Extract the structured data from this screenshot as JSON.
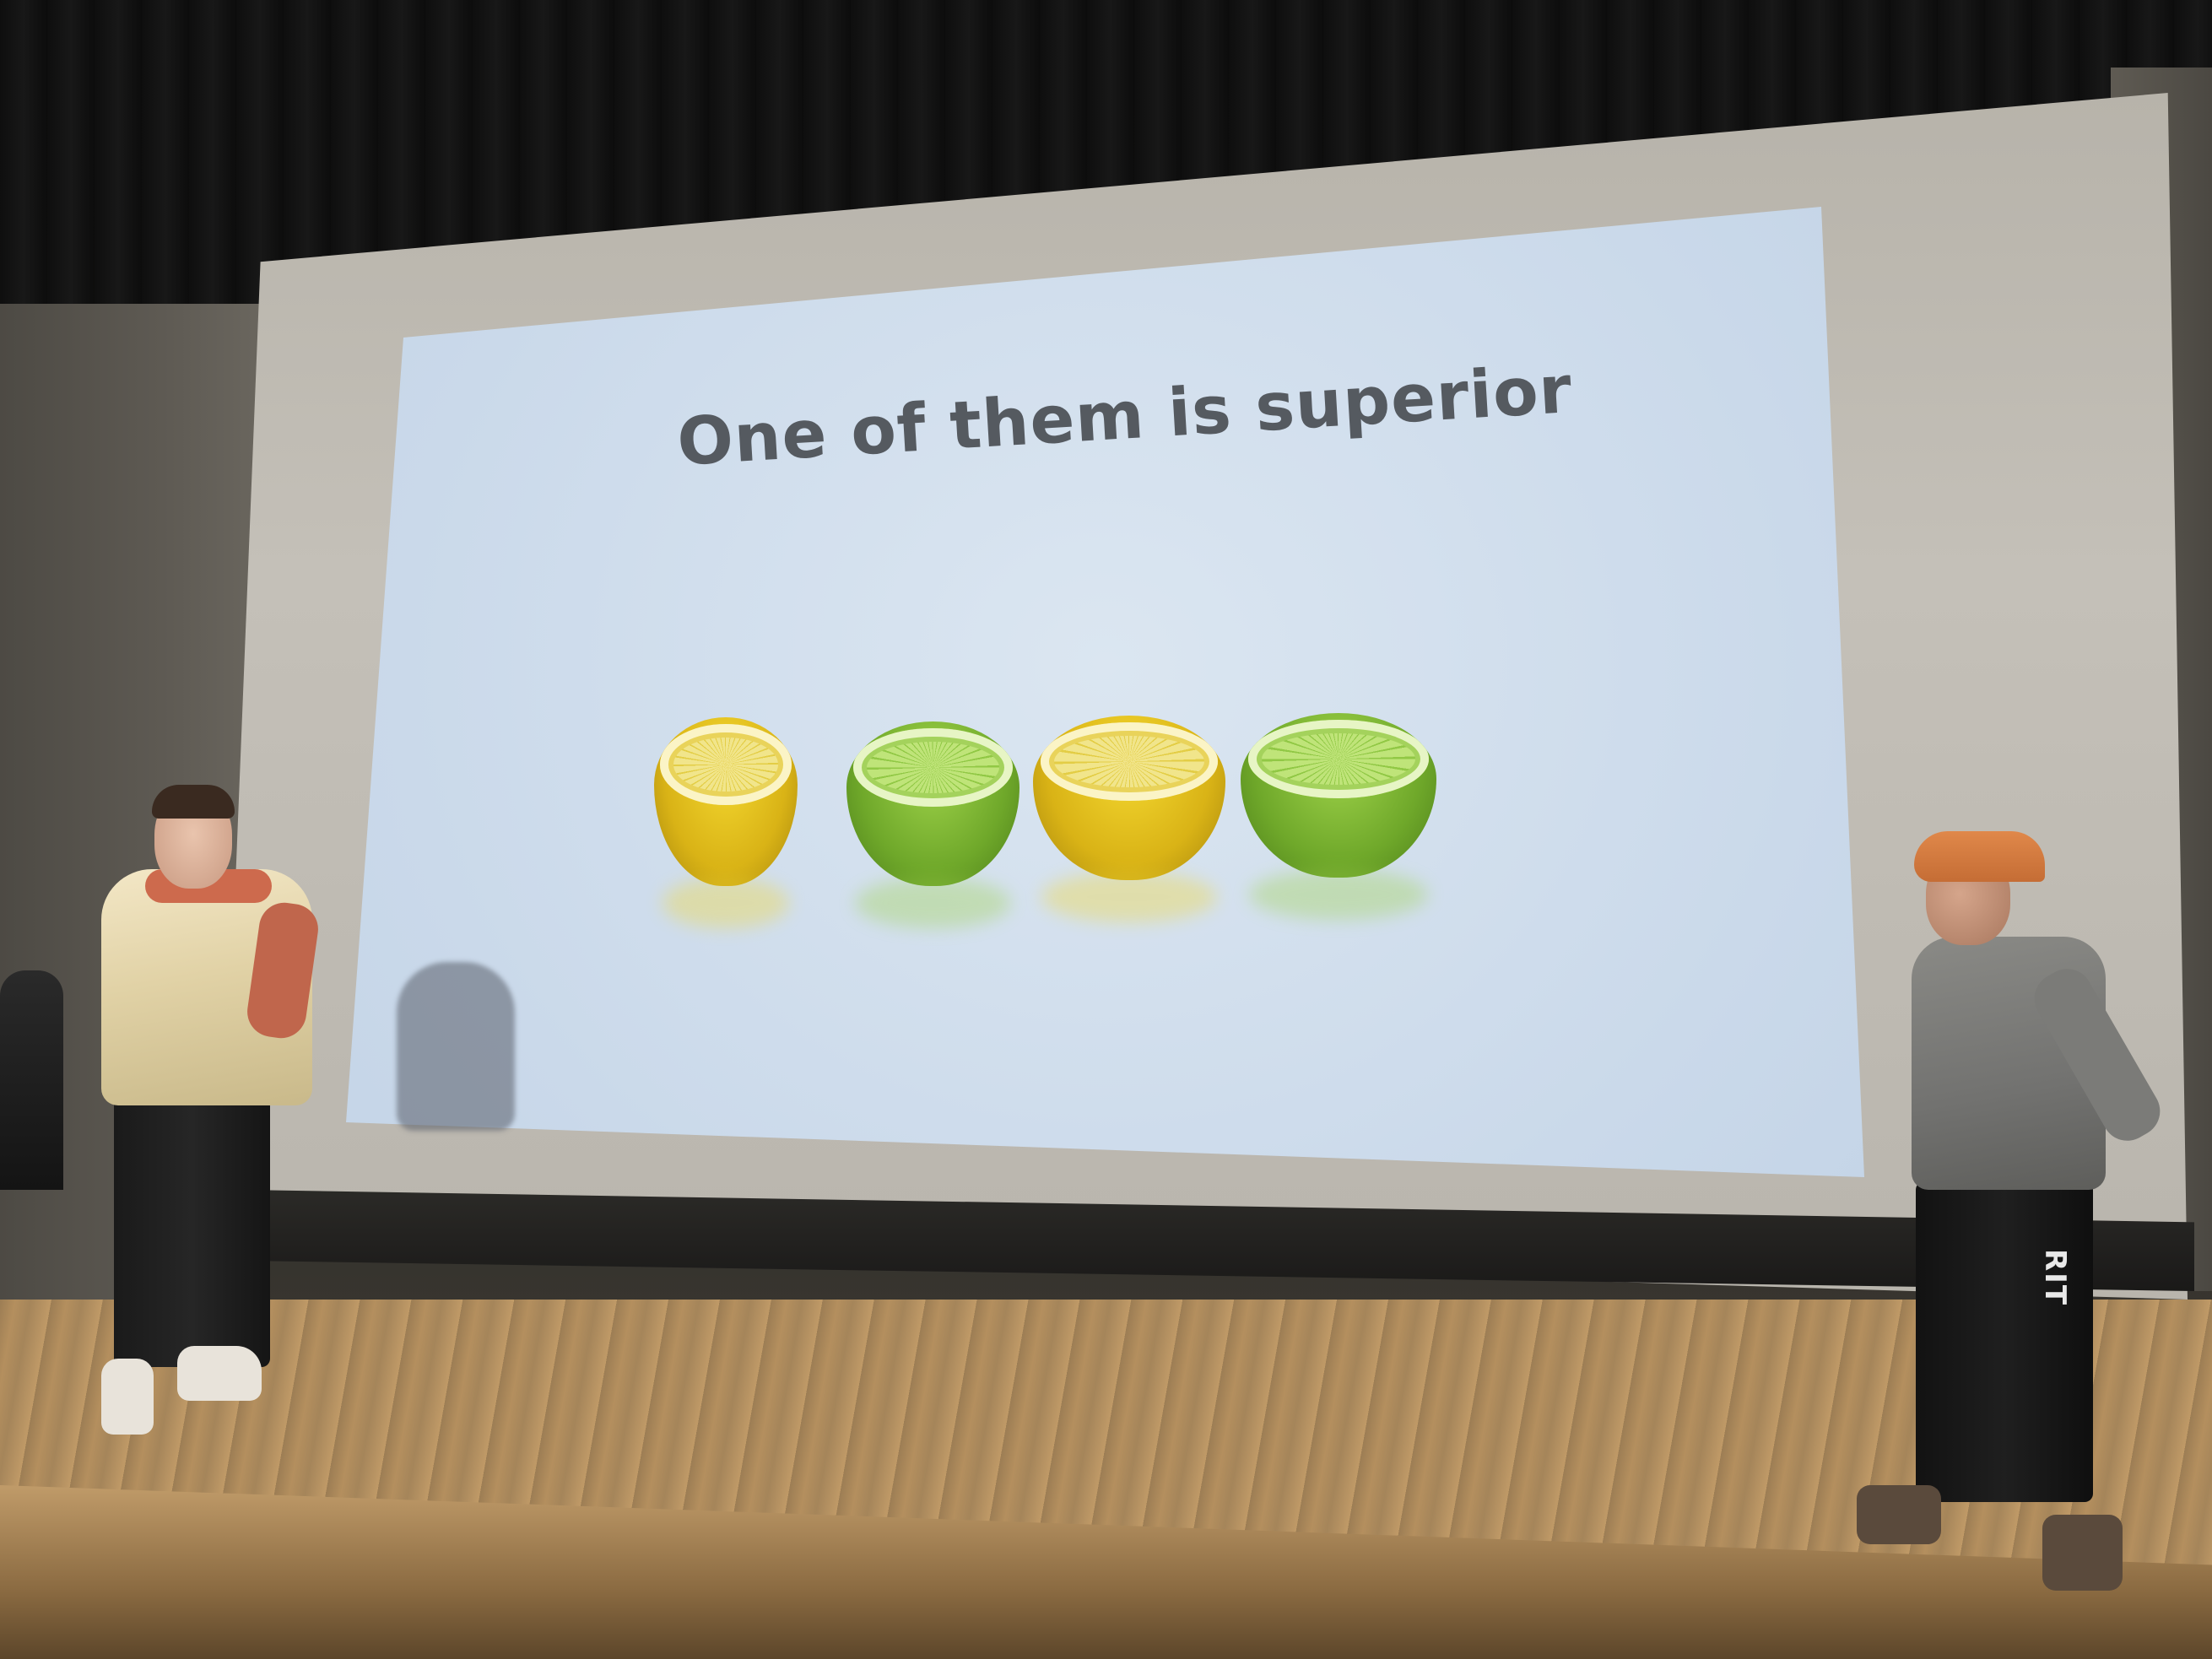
{
  "slide": {
    "title": "One of them is superior"
  },
  "fruits": [
    {
      "kind": "lemon"
    },
    {
      "kind": "lime"
    },
    {
      "kind": "lemon"
    },
    {
      "kind": "lime"
    }
  ],
  "pants_logo": "RIT",
  "colors": {
    "lemon": "#f4d830",
    "lime": "#9fd34a",
    "slide_background": "#d4e1ef",
    "title_text": "#555a60"
  }
}
